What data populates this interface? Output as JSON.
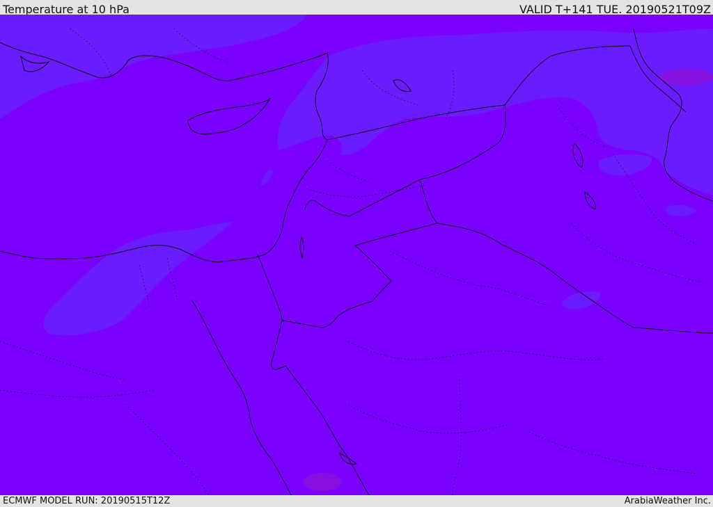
{
  "header": {
    "title": "Temperature at 10 hPa",
    "valid_time": "VALID T+141 TUE. 20190521T09Z"
  },
  "footer": {
    "model_run": "ECMWF MODEL RUN: 20190515T12Z",
    "credit": "ArabiaWeather Inc."
  },
  "map": {
    "field": "Temperature at 10 hPa",
    "colors": {
      "dominant_shade": "#7a00ff",
      "cooler_shade": "#6a1cff",
      "warmer_shade": "#8a10d8",
      "coastline": "#0a0a14",
      "borders": "#1a1030"
    }
  }
}
